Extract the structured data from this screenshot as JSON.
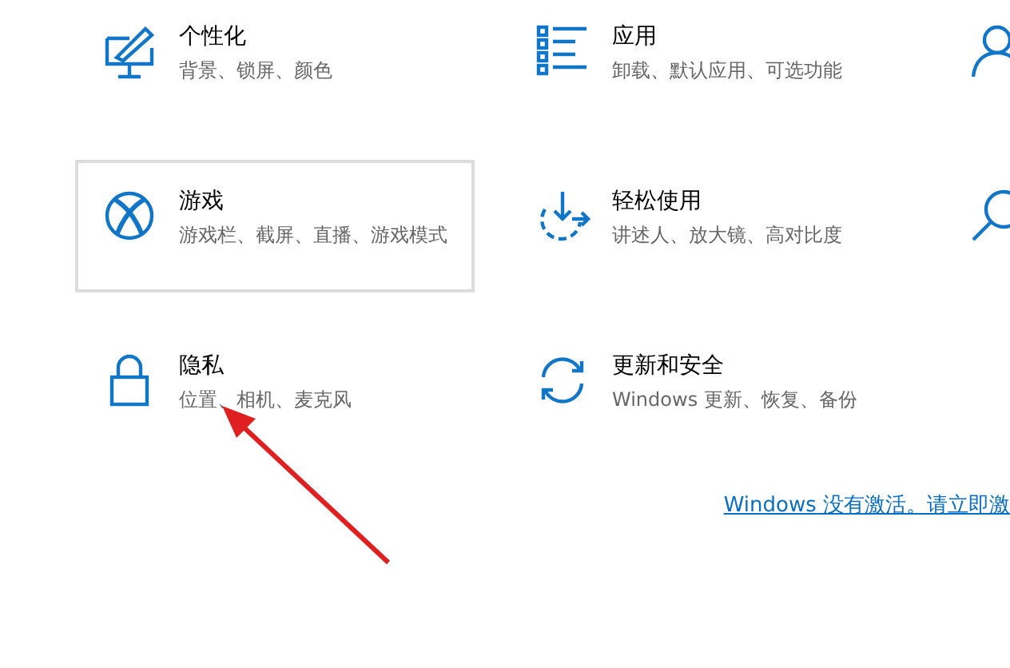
{
  "tiles": [
    {
      "kind": "monitor-brush",
      "title": "个性化",
      "description": "背景、锁屏、颜色",
      "hovered": false
    },
    {
      "kind": "list",
      "title": "应用",
      "description": "卸载、默认应用、可选功能",
      "hovered": false
    },
    {
      "kind": "person",
      "hovered": false
    },
    {
      "kind": "xbox",
      "title": "游戏",
      "description": "游戏栏、截屏、直播、游戏模式",
      "hovered": true
    },
    {
      "kind": "ease",
      "title": "轻松使用",
      "description": "讲述人、放大镜、高对比度",
      "hovered": false
    },
    {
      "kind": "search",
      "hovered": false
    },
    {
      "kind": "lock",
      "title": "隐私",
      "description": "位置、相机、麦克风",
      "hovered": false
    },
    {
      "kind": "sync",
      "title": "更新和安全",
      "description": "Windows 更新、恢复、备份",
      "hovered": false
    }
  ],
  "activation_link": "Windows 没有激活。请立即激"
}
